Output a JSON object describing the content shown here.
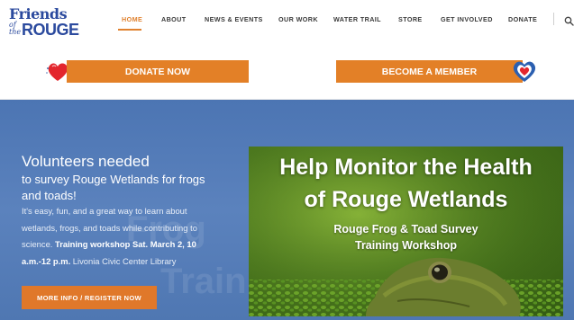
{
  "site": {
    "logo": {
      "line1": "Friends",
      "line2": "of",
      "line3": "the",
      "line4": "ROUGE"
    }
  },
  "nav": {
    "items": [
      {
        "label": "HOME",
        "active": true
      },
      {
        "label": "ABOUT"
      },
      {
        "label": "NEWS & EVENTS"
      },
      {
        "label": "OUR WORK"
      },
      {
        "label": "WATER TRAIL"
      },
      {
        "label": "STORE"
      },
      {
        "label": "GET INVOLVED"
      },
      {
        "label": "DONATE"
      }
    ],
    "search_icon": "search-icon",
    "active_color": "#e08230"
  },
  "cta": {
    "donate_label": "DONATE NOW",
    "member_label": "BECOME A MEMBER",
    "color": "#e38027"
  },
  "hero": {
    "title": "Volunteers needed",
    "subtitle_line1": "to survey Rouge Wetlands for frogs",
    "subtitle_line2": "and toads!",
    "body_line1": "It's easy, fun, and a great way to learn about",
    "body_line2": "wetlands, frogs, and toads while contributing to",
    "body_line3_plain": "science. ",
    "body_line3_bold": "Training workshop Sat. March 2, 10",
    "body_line4_bold": "a.m.-12 p.m.",
    "body_line4_plain": " Livonia Civic Center Library",
    "button_label": "MORE INFO / REGISTER NOW",
    "background_color": "#5a7fbc"
  },
  "promo": {
    "headline_line1": "Help Monitor the Health",
    "headline_line2": "of Rouge Wetlands",
    "sub_line1": "Rouge Frog & Toad Survey",
    "sub_line2": "Training Workshop"
  }
}
